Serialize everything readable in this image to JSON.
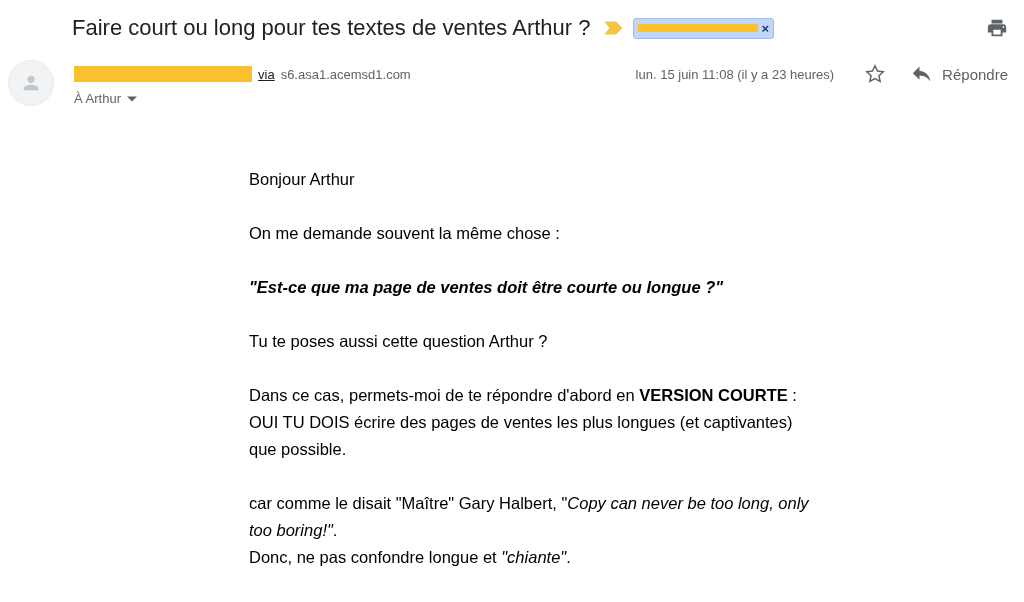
{
  "subject": {
    "title": "Faire court ou long pour tes textes de ventes Arthur ?",
    "important": true,
    "label": {
      "remove": "×"
    }
  },
  "sender": {
    "via_label": "via",
    "via_domain": "s6.asa1.acemsd1.com",
    "recipient": "À Arthur",
    "date": "lun. 15 juin 11:08 (il y a 23 heures)",
    "starred": false,
    "reply": "Répondre"
  },
  "body": [
    {
      "kind": "plain",
      "text": "Bonjour Arthur"
    },
    {
      "kind": "plain",
      "text": "On me demande souvent la même chose :"
    },
    {
      "kind": "emphasis",
      "text": "\"Est-ce que ma page de ventes doit être courte ou longue ?\""
    },
    {
      "kind": "plain",
      "text": "Tu te poses aussi cette question Arthur ?"
    },
    {
      "kind": "plain",
      "text": "Dans ce cas, permets-moi de te répondre d'abord en **VERSION COURTE** :\nOUI TU DOIS écrire des pages de ventes les plus longues (et captivantes)\nque possible."
    },
    {
      "kind": "plain",
      "text": "car comme le disait \"Maître\" Gary Halbert, \"*Copy can never be too long, only*\n*too boring!\"*.\nDonc, ne pas confondre longue et *\"chiante\"*."
    }
  ]
}
